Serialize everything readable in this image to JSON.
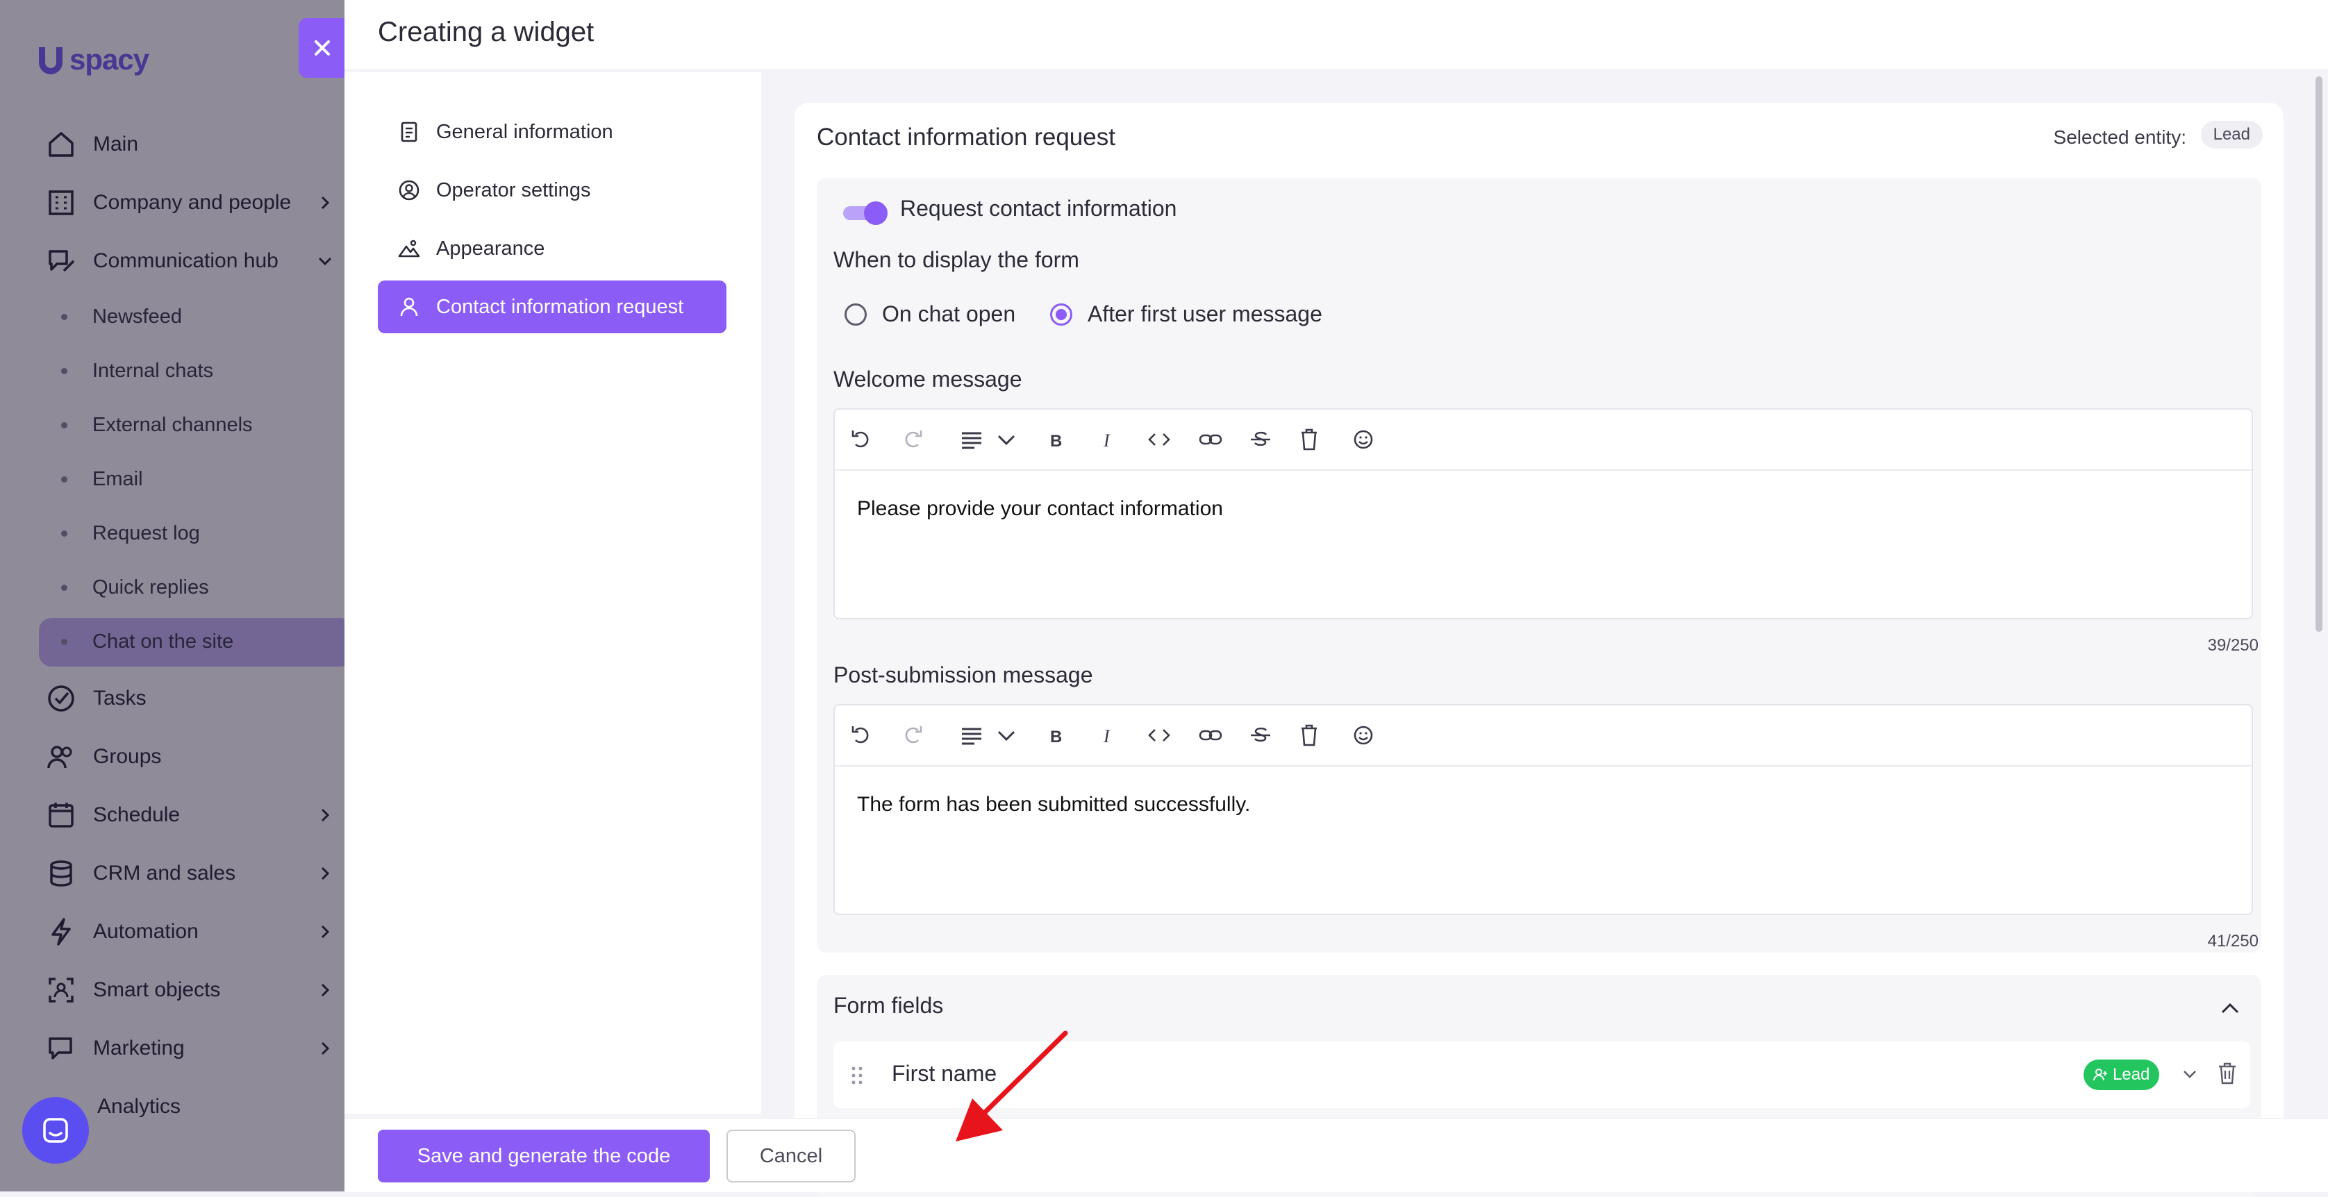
{
  "app": {
    "logo_text": "spacy"
  },
  "sidebar": {
    "items": [
      {
        "label": "Main",
        "icon": "home-icon"
      },
      {
        "label": "Company and people",
        "icon": "building-icon"
      },
      {
        "label": "Communication hub",
        "icon": "chat-edit-icon"
      },
      {
        "label": "Tasks",
        "icon": "check-circle-icon"
      },
      {
        "label": "Groups",
        "icon": "users-icon"
      },
      {
        "label": "Schedule",
        "icon": "calendar-icon"
      },
      {
        "label": "CRM and sales",
        "icon": "database-icon"
      },
      {
        "label": "Automation",
        "icon": "bolt-icon"
      },
      {
        "label": "Smart objects",
        "icon": "smart-object-icon"
      },
      {
        "label": "Marketing",
        "icon": "marketing-icon"
      },
      {
        "label": "Analytics",
        "icon": "analytics-icon"
      }
    ],
    "sub_items": [
      "Newsfeed",
      "Internal chats",
      "External channels",
      "Email",
      "Request log",
      "Quick replies",
      "Chat on the site"
    ],
    "active_sub_item": "Chat on the site"
  },
  "drawer": {
    "title": "Creating a widget",
    "menu": [
      {
        "label": "General information",
        "icon": "document-icon"
      },
      {
        "label": "Operator settings",
        "icon": "user-circle-icon"
      },
      {
        "label": "Appearance",
        "icon": "landscape-icon"
      },
      {
        "label": "Contact information request",
        "icon": "user-icon",
        "active": true
      }
    ],
    "card": {
      "title": "Contact information request",
      "selected_entity_label": "Selected entity:",
      "selected_entity": "Lead",
      "toggle_label": "Request contact information",
      "toggle_on": true,
      "display_label": "When to display the form",
      "radio_options": [
        "On chat open",
        "After first user message"
      ],
      "radio_selected": "After first user message",
      "welcome": {
        "label": "Welcome message",
        "text": "Please provide your contact information",
        "counter": "39/250"
      },
      "post": {
        "label": "Post-submission message",
        "text": "The form has been submitted successfully.",
        "counter": "41/250"
      },
      "toolbar_icons": [
        "undo-icon",
        "redo-icon",
        "align-icon",
        "bold-icon",
        "italic-icon",
        "code-icon",
        "link-icon",
        "strikethrough-icon",
        "clear-format-icon",
        "emoji-icon"
      ],
      "form_fields": {
        "label": "Form fields",
        "rows": [
          {
            "label": "First name",
            "badge": "Lead"
          }
        ]
      }
    },
    "footer": {
      "save_label": "Save and generate the code",
      "cancel_label": "Cancel"
    }
  },
  "colors": {
    "accent": "#8b5cf6",
    "lead_badge": "#22c55e",
    "overlay": "#140c28"
  }
}
